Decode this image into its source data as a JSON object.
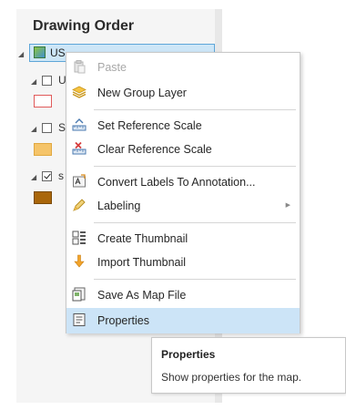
{
  "pane": {
    "title": "Drawing Order",
    "map": {
      "label": "US"
    },
    "layers": [
      {
        "letter": "U",
        "checked": false,
        "swatch_fill": "#ffffff",
        "swatch_border": "#e05a5a"
      },
      {
        "letter": "S",
        "checked": false,
        "swatch_fill": "#f5c469",
        "swatch_border": "#e0a840"
      },
      {
        "letter": "s",
        "checked": true,
        "swatch_fill": "#a9660a",
        "swatch_border": "#7a4a06"
      }
    ]
  },
  "context_menu": {
    "items": [
      {
        "label": "Paste",
        "icon": "paste-icon",
        "disabled": true
      },
      {
        "label": "New Group Layer",
        "icon": "group-layer-icon"
      },
      {
        "label": "Set Reference Scale",
        "icon": "set-scale-icon"
      },
      {
        "label": "Clear Reference Scale",
        "icon": "clear-scale-icon"
      },
      {
        "label": "Convert Labels To Annotation...",
        "icon": "convert-labels-icon"
      },
      {
        "label": "Labeling",
        "icon": "labeling-icon",
        "has_submenu": true
      },
      {
        "label": "Create Thumbnail",
        "icon": "create-thumbnail-icon"
      },
      {
        "label": "Import Thumbnail",
        "icon": "import-thumbnail-icon"
      },
      {
        "label": "Save As Map File",
        "icon": "save-map-file-icon"
      },
      {
        "label": "Properties",
        "icon": "properties-icon",
        "highlighted": true
      }
    ]
  },
  "tooltip": {
    "title": "Properties",
    "body": "Show properties for the map."
  },
  "colors": {
    "highlight": "#cce4f7",
    "selected_row": "#cde6f7"
  }
}
